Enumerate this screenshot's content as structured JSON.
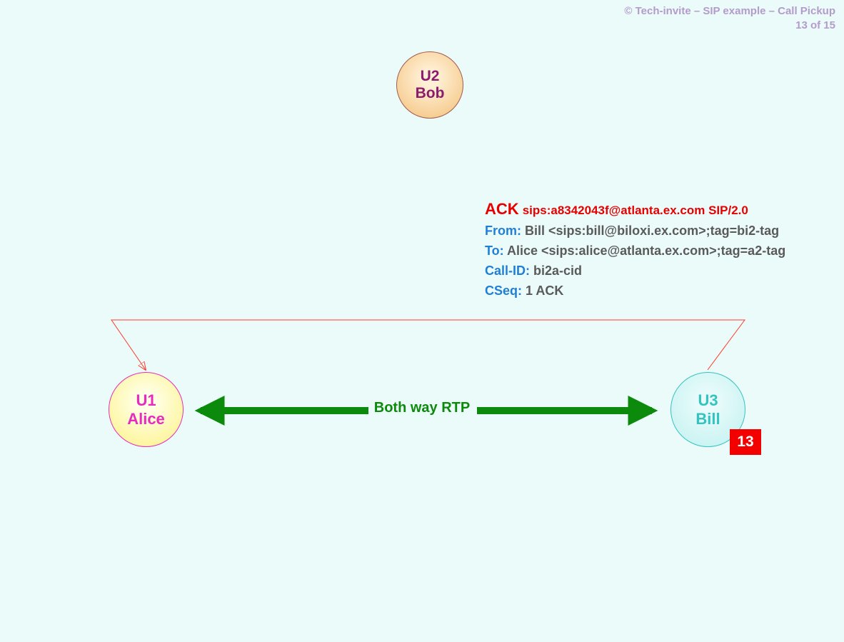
{
  "header": {
    "copyright": "© Tech-invite – SIP example – Call Pickup",
    "pager": "13 of 15"
  },
  "nodes": {
    "u2": {
      "id": "U2",
      "name": "Bob"
    },
    "u1": {
      "id": "U1",
      "name": "Alice"
    },
    "u3": {
      "id": "U3",
      "name": "Bill"
    }
  },
  "sip_message": {
    "method": "ACK",
    "request_uri": "sips:a8342043f@atlanta.ex.com SIP/2.0",
    "headers": {
      "from_label": "From",
      "from_value": "Bill <sips:bill@biloxi.ex.com>;tag=bi2-tag",
      "to_label": "To",
      "to_value": "Alice <sips:alice@atlanta.ex.com>;tag=a2-tag",
      "callid_label": "Call-ID",
      "callid_value": "bi2a-cid",
      "cseq_label": "CSeq",
      "cseq_value": "1 ACK"
    }
  },
  "media": {
    "label": "Both way RTP"
  },
  "step": {
    "number": "13"
  }
}
